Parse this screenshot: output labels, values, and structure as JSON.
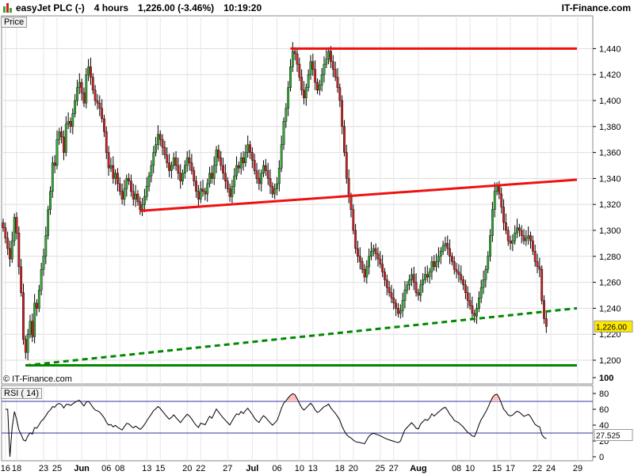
{
  "header": {
    "symbol": "easyJet PLC (-)",
    "interval": "4 hours",
    "quote": "1,226.00 (-3.46%)",
    "time": "10:19:20",
    "brand": "IT-Finance.com"
  },
  "panels": {
    "price_label": "Price",
    "rsi_label": "RSI ( 14)",
    "watermark": "© IT-Finance.com"
  },
  "colors": {
    "up": "#33aa33",
    "down": "#cc2222",
    "resistance": "#ee1111",
    "support": "#008800",
    "rsi_line": "#000000",
    "rsi_bands": "#3333aa"
  },
  "chart_data": [
    {
      "type": "candlestick",
      "title": "easyJet PLC (-) 4 hours",
      "y_ticks": [
        "1,200",
        "1,220",
        "1,240",
        "1,260",
        "1,280",
        "1,300",
        "1,320",
        "1,340",
        "1,360",
        "1,380",
        "1,400",
        "1,420",
        "1,440"
      ],
      "ylim": [
        1190,
        1450
      ],
      "x_ticks": [
        {
          "label": "16",
          "i": 1
        },
        {
          "label": "18",
          "i": 6
        },
        {
          "label": "23",
          "i": 18
        },
        {
          "label": "25",
          "i": 24
        },
        {
          "label": "Jun",
          "i": 35,
          "bold": true
        },
        {
          "label": "06",
          "i": 46
        },
        {
          "label": "08",
          "i": 52
        },
        {
          "label": "13",
          "i": 64
        },
        {
          "label": "15",
          "i": 70
        },
        {
          "label": "20",
          "i": 82
        },
        {
          "label": "22",
          "i": 88
        },
        {
          "label": "27",
          "i": 100
        },
        {
          "label": "Jul",
          "i": 111,
          "bold": true
        },
        {
          "label": "06",
          "i": 122
        },
        {
          "label": "10",
          "i": 132
        },
        {
          "label": "13",
          "i": 138
        },
        {
          "label": "18",
          "i": 150
        },
        {
          "label": "20",
          "i": 156
        },
        {
          "label": "25",
          "i": 168
        },
        {
          "label": "27",
          "i": 174
        },
        {
          "label": "Aug",
          "i": 185,
          "bold": true
        },
        {
          "label": "08",
          "i": 202
        },
        {
          "label": "10",
          "i": 208
        },
        {
          "label": "15",
          "i": 220
        },
        {
          "label": "17",
          "i": 226
        },
        {
          "label": "22",
          "i": 238
        },
        {
          "label": "24",
          "i": 244
        },
        {
          "label": "29",
          "i": 256
        }
      ],
      "last_value": "1,226.00",
      "closes": [
        1302,
        1294,
        1286,
        1278,
        1292,
        1310,
        1298,
        1272,
        1252,
        1216,
        1206,
        1220,
        1230,
        1218,
        1244,
        1240,
        1254,
        1270,
        1280,
        1296,
        1316,
        1330,
        1352,
        1350,
        1370,
        1376,
        1372,
        1360,
        1382,
        1384,
        1380,
        1390,
        1400,
        1410,
        1414,
        1406,
        1398,
        1420,
        1426,
        1418,
        1408,
        1400,
        1398,
        1394,
        1386,
        1376,
        1360,
        1348,
        1350,
        1340,
        1344,
        1336,
        1330,
        1324,
        1332,
        1340,
        1338,
        1330,
        1324,
        1328,
        1322,
        1316,
        1320,
        1326,
        1334,
        1342,
        1350,
        1360,
        1366,
        1374,
        1370,
        1364,
        1358,
        1352,
        1346,
        1350,
        1356,
        1350,
        1344,
        1338,
        1344,
        1350,
        1356,
        1352,
        1346,
        1338,
        1330,
        1324,
        1332,
        1330,
        1328,
        1336,
        1344,
        1340,
        1350,
        1362,
        1356,
        1350,
        1344,
        1338,
        1332,
        1326,
        1334,
        1342,
        1350,
        1348,
        1356,
        1352,
        1360,
        1366,
        1360,
        1354,
        1346,
        1340,
        1336,
        1344,
        1350,
        1346,
        1340,
        1334,
        1328,
        1332,
        1336,
        1348,
        1366,
        1384,
        1394,
        1410,
        1426,
        1438,
        1436,
        1428,
        1418,
        1408,
        1402,
        1410,
        1420,
        1430,
        1424,
        1414,
        1408,
        1412,
        1420,
        1428,
        1432,
        1438,
        1430,
        1424,
        1418,
        1410,
        1400,
        1380,
        1360,
        1340,
        1326,
        1316,
        1300,
        1286,
        1280,
        1276,
        1270,
        1264,
        1272,
        1280,
        1284,
        1286,
        1282,
        1278,
        1274,
        1268,
        1262,
        1256,
        1252,
        1248,
        1244,
        1240,
        1236,
        1238,
        1246,
        1254,
        1258,
        1262,
        1266,
        1260,
        1252,
        1250,
        1258,
        1262,
        1266,
        1264,
        1268,
        1276,
        1272,
        1276,
        1280,
        1284,
        1288,
        1290,
        1286,
        1280,
        1276,
        1270,
        1268,
        1266,
        1262,
        1258,
        1252,
        1246,
        1242,
        1236,
        1234,
        1240,
        1248,
        1256,
        1262,
        1270,
        1280,
        1296,
        1316,
        1330,
        1334,
        1328,
        1318,
        1306,
        1300,
        1292,
        1290,
        1292,
        1298,
        1302,
        1300,
        1296,
        1292,
        1294,
        1296,
        1292,
        1284,
        1276,
        1272,
        1270,
        1246,
        1232,
        1226
      ]
    },
    {
      "type": "line",
      "title": "RSI ( 14)",
      "y_ticks": [
        "0",
        "20",
        "40",
        "60",
        "80",
        "100"
      ],
      "ylim": [
        0,
        100
      ],
      "bands": [
        30,
        70
      ],
      "last_value": "27.525"
    }
  ]
}
